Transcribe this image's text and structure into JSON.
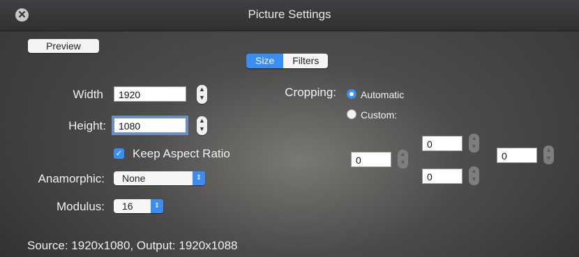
{
  "window": {
    "title": "Picture Settings"
  },
  "toolbar": {
    "preview_label": "Preview"
  },
  "tabs": [
    {
      "label": "Size",
      "active": true
    },
    {
      "label": "Filters",
      "active": false
    }
  ],
  "size": {
    "width_label": "Width",
    "width_value": "1920",
    "height_label": "Height:",
    "height_value": "1080",
    "keep_aspect_label": "Keep Aspect Ratio",
    "keep_aspect_checked": true,
    "anamorphic_label": "Anamorphic:",
    "anamorphic_value": "None",
    "modulus_label": "Modulus:",
    "modulus_value": "16"
  },
  "cropping": {
    "label": "Cropping:",
    "automatic_label": "Automatic",
    "custom_label": "Custom:",
    "selected": "Automatic",
    "top": "0",
    "left": "0",
    "right": "0",
    "bottom": "0"
  },
  "status": "Source: 1920x1080, Output: 1920x1088",
  "icons": {
    "close": "close-icon",
    "stepper": "stepper-icon",
    "popup_arrow": "chevron-updown-icon",
    "check": "checkmark-icon"
  },
  "colors": {
    "accent": "#3a8ef3",
    "focus_ring": "#6b8fc2"
  }
}
